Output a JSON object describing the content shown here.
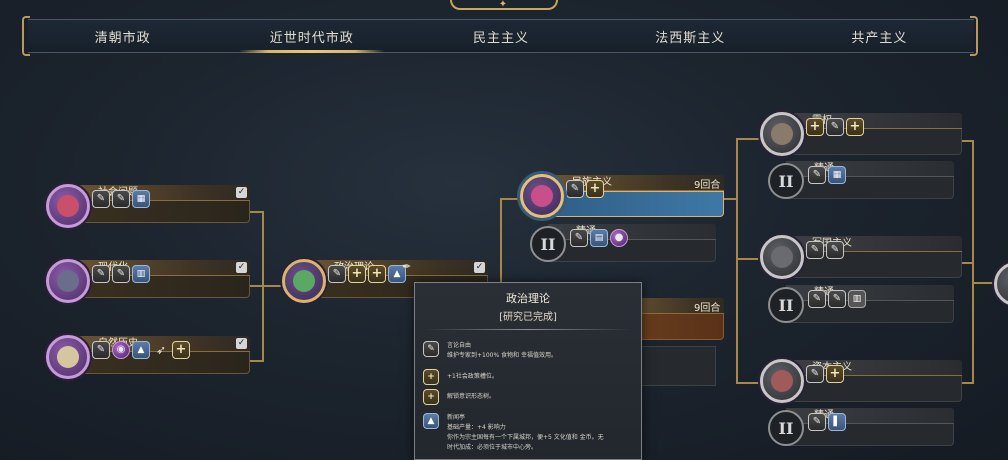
{
  "tabs": [
    {
      "label": "清朝市政",
      "active": false
    },
    {
      "label": "近世时代市政",
      "active": true
    },
    {
      "label": "民主主义",
      "active": false
    },
    {
      "label": "法西斯主义",
      "active": false
    },
    {
      "label": "共产主义",
      "active": false
    }
  ],
  "nodes": {
    "social_issues": {
      "title": "社会问题",
      "completed": true
    },
    "modernization": {
      "title": "现代化",
      "completed": true
    },
    "natural_history": {
      "title": "自然历史",
      "completed": true
    },
    "political_theory": {
      "title": "政治理论",
      "completed": true
    },
    "nationalism": {
      "title": "民族主义",
      "turns": "9回合",
      "selected": true
    },
    "nationalism_mastery": {
      "title": "精通",
      "mark": "II"
    },
    "hidden_node": {
      "turns": "9回合"
    },
    "hegemony": {
      "title": "霸权"
    },
    "hegemony_mastery": {
      "title": "精通",
      "mark": "II"
    },
    "militarism": {
      "title": "军国主义"
    },
    "militarism_mastery": {
      "title": "精通",
      "mark": "II"
    },
    "capitalism": {
      "title": "资本主义"
    },
    "capitalism_mastery": {
      "title": "精通",
      "mark": "II"
    }
  },
  "tooltip": {
    "title": "政治理论",
    "subtitle": "[研究已完成]",
    "entries": [
      {
        "icon": "policy-card-icon",
        "heading": "言论自由",
        "text": "维护专家到+100% 食物和 幸福值效用。"
      },
      {
        "icon": "plus-slot-icon",
        "heading": "",
        "text": "+1社会政策槽位。"
      },
      {
        "icon": "plus-slot-icon",
        "heading": "",
        "text": "解锁意识形态树。"
      },
      {
        "icon": "building-icon",
        "heading": "新闻亭",
        "text": "基础产量：+4 影响力"
      },
      {
        "icon": "",
        "heading": "",
        "text": "你作为宗主国每有一个下属城邦，便+5 文化值和 金币。无"
      },
      {
        "icon": "",
        "heading": "",
        "text": "时代加成：必须位于城市中心旁。"
      }
    ]
  },
  "colors": {
    "accent_gold": "#d8b56a",
    "selected_blue": "#3f78a6",
    "background": "#1c242e"
  }
}
